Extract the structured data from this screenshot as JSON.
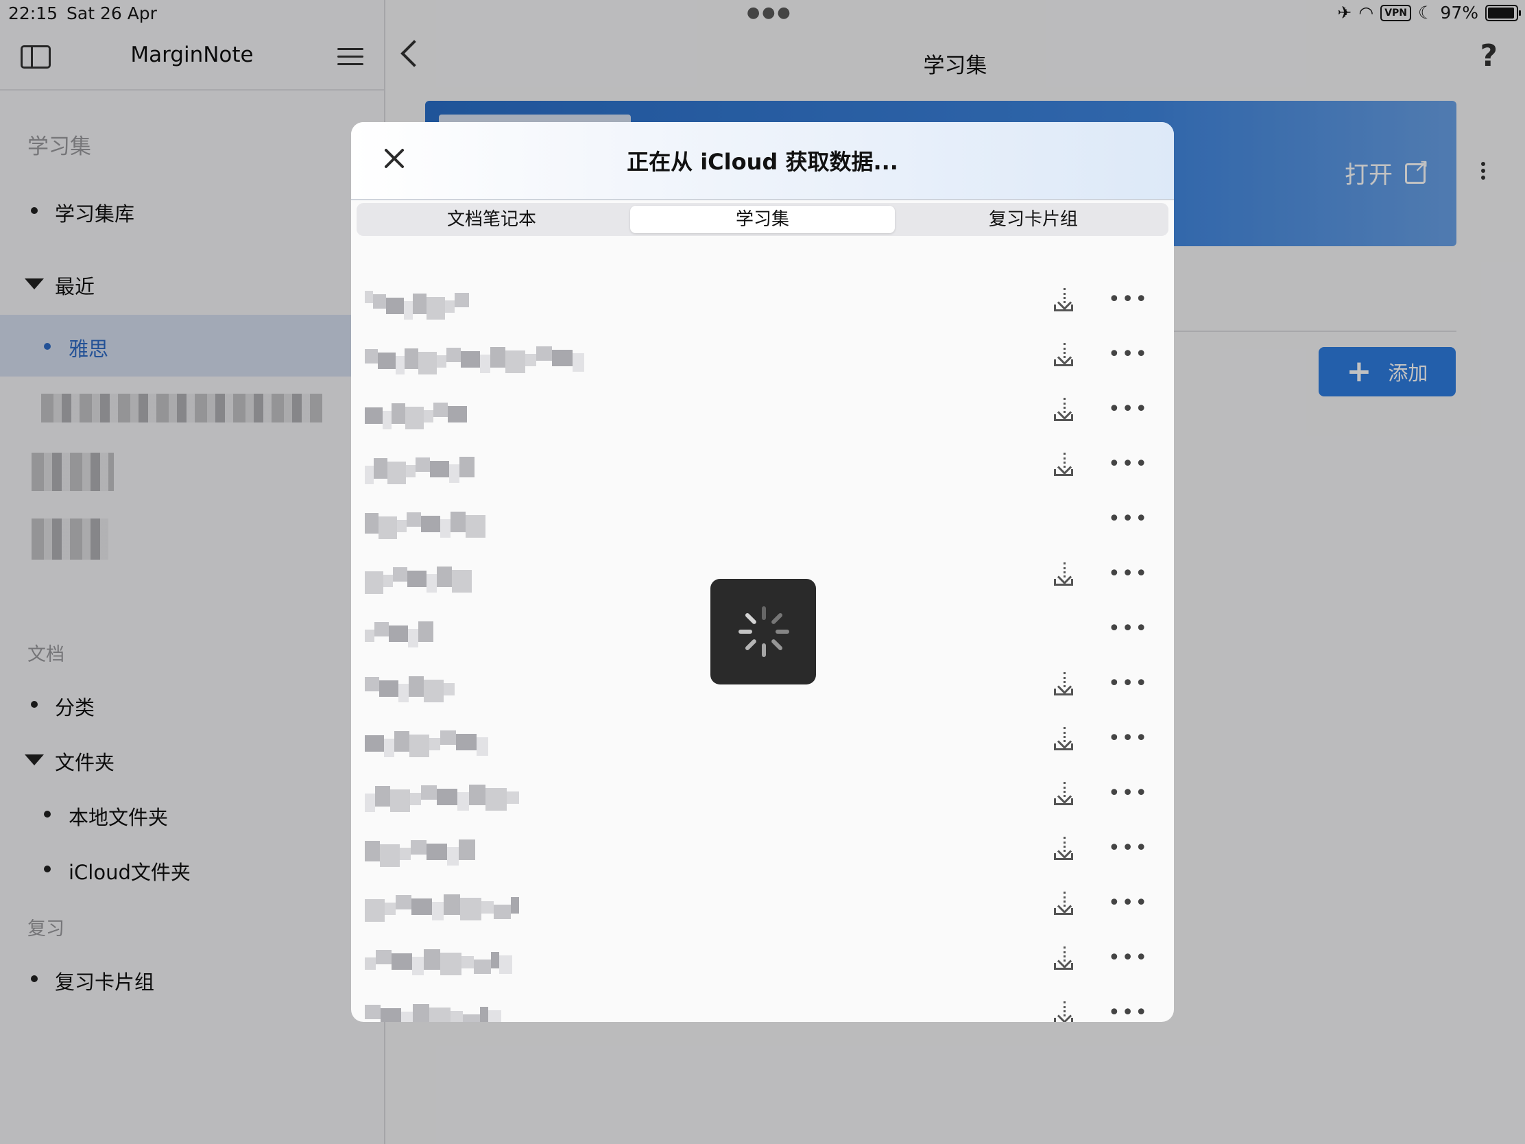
{
  "status": {
    "time": "22:15",
    "date": "Sat 26 Apr",
    "battery": "97%",
    "vpn": "VPN"
  },
  "sidebar": {
    "title": "MarginNote",
    "section_learn": "学习集",
    "item_library": "学习集库",
    "item_recent": "最近",
    "item_recent_selected": "雅思",
    "section_docs": "文档",
    "item_category": "分类",
    "item_folders": "文件夹",
    "item_local_folder": "本地文件夹",
    "item_icloud_folder": "iCloud文件夹",
    "section_review": "复习",
    "item_review_decks": "复习卡片组"
  },
  "main": {
    "title": "学习集",
    "help": "?",
    "open_label": "打开",
    "add_label": "添加",
    "accent": "#2f7de1"
  },
  "modal": {
    "title": "正在从 iCloud 获取数据...",
    "tabs": [
      "文档笔记本",
      "学习集",
      "复习卡片组"
    ],
    "active_tab": 1,
    "more_glyph": "•••",
    "rows": [
      {
        "download": true
      },
      {
        "download": true
      },
      {
        "download": true
      },
      {
        "download": true
      },
      {
        "download": false
      },
      {
        "download": true
      },
      {
        "download": false
      },
      {
        "download": true
      },
      {
        "download": true
      },
      {
        "download": true
      },
      {
        "download": true
      },
      {
        "download": true
      },
      {
        "download": true
      },
      {
        "download": true
      }
    ]
  }
}
